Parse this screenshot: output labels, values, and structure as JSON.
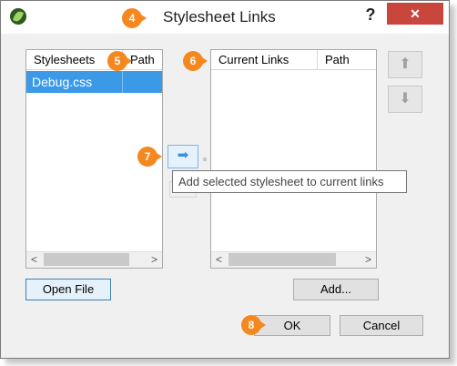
{
  "window": {
    "title": "Stylesheet Links",
    "help_label": "?",
    "close_label": "✕"
  },
  "stylesheets_panel": {
    "columns": [
      "Stylesheets",
      "Path"
    ],
    "rows": [
      {
        "name": "Debug.css",
        "path": ""
      }
    ],
    "scroll_left": "<",
    "scroll_right": ">"
  },
  "current_links_panel": {
    "columns": [
      "Current Links",
      "Path"
    ],
    "scroll_left": "<",
    "scroll_right": ">"
  },
  "buttons": {
    "open_file": "Open File",
    "add": "Add...",
    "ok": "OK",
    "cancel": "Cancel",
    "move_up": "⬆",
    "move_down": "⬇",
    "add_to_links": "➡"
  },
  "tooltip": "Add selected stylesheet to current links",
  "callouts": [
    "4",
    "5",
    "6",
    "7",
    "8"
  ],
  "colors": {
    "selection": "#3a9ae8",
    "close_button": "#c9463c",
    "callout": "#f5871f"
  }
}
